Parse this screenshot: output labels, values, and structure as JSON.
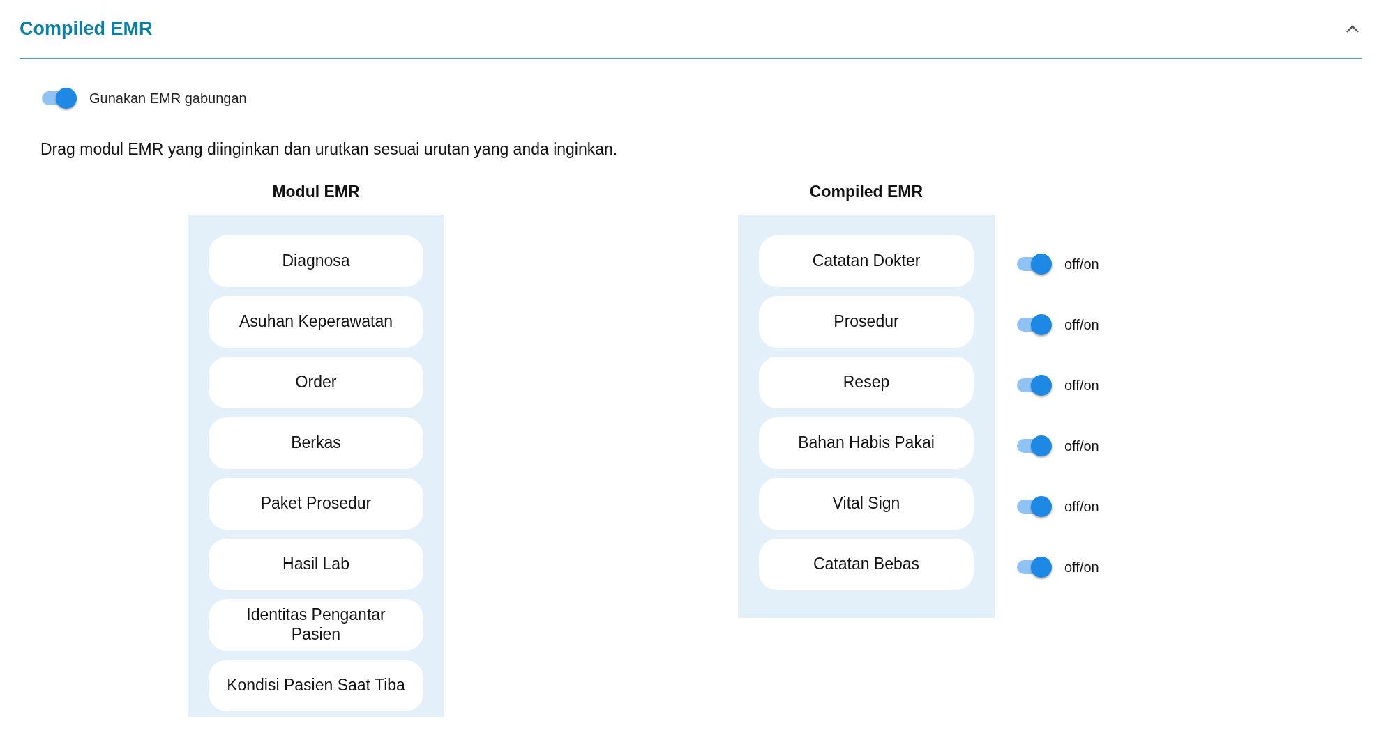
{
  "section": {
    "title": "Compiled EMR",
    "expanded": true
  },
  "use_compiled": {
    "label": "Gunakan EMR gabungan",
    "on": true
  },
  "instruction": "Drag modul EMR yang diinginkan dan urutkan sesuai urutan yang anda inginkan.",
  "modules": {
    "title": "Modul EMR",
    "items": [
      {
        "label": "Diagnosa"
      },
      {
        "label": "Asuhan Keperawatan"
      },
      {
        "label": "Order"
      },
      {
        "label": "Berkas"
      },
      {
        "label": "Paket Prosedur"
      },
      {
        "label": "Hasil Lab"
      },
      {
        "label": "Identitas Pengantar Pasien"
      },
      {
        "label": "Kondisi Pasien Saat Tiba"
      }
    ]
  },
  "compiled": {
    "title": "Compiled EMR",
    "items": [
      {
        "label": "Catatan Dokter",
        "on": true,
        "toggle_label": "off/on"
      },
      {
        "label": "Prosedur",
        "on": true,
        "toggle_label": "off/on"
      },
      {
        "label": "Resep",
        "on": true,
        "toggle_label": "off/on"
      },
      {
        "label": "Bahan Habis Pakai",
        "on": true,
        "toggle_label": "off/on"
      },
      {
        "label": "Vital Sign",
        "on": true,
        "toggle_label": "off/on"
      },
      {
        "label": "Catatan Bebas",
        "on": true,
        "toggle_label": "off/on"
      }
    ]
  }
}
